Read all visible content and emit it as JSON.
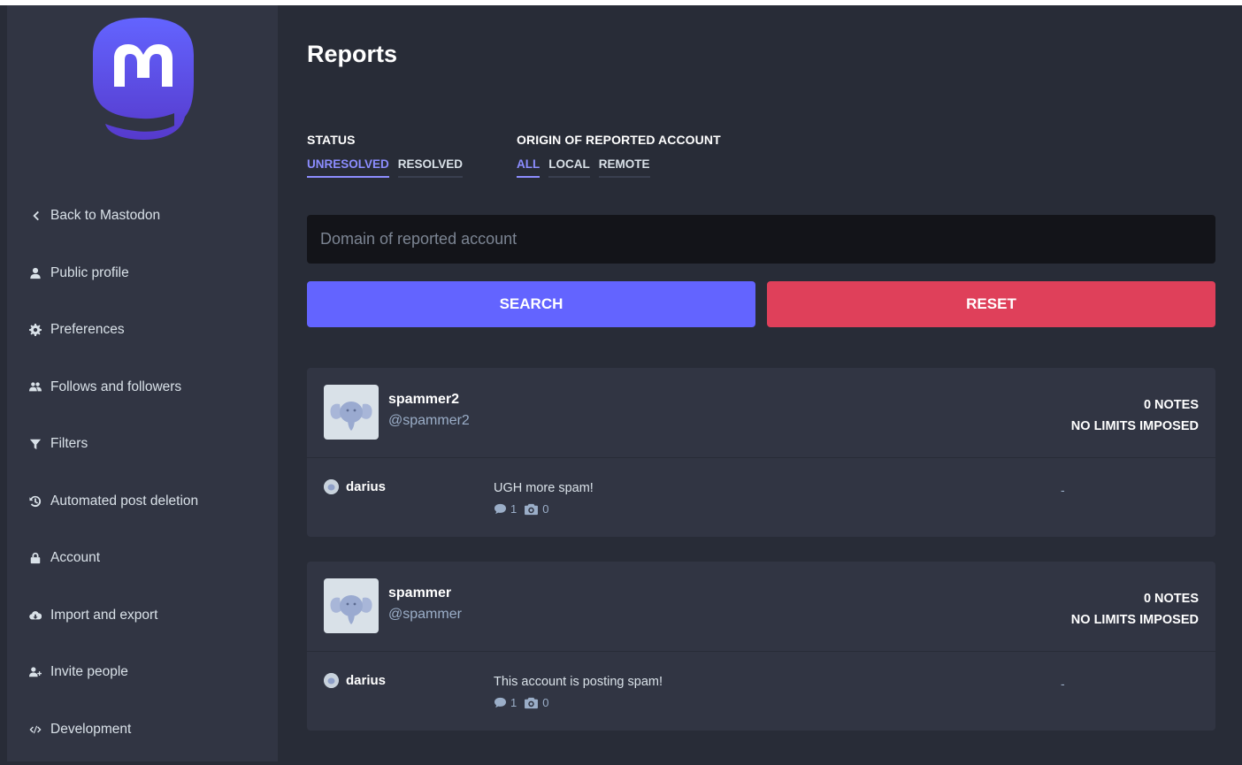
{
  "sidebar": {
    "logo_icon": "mastodon-logo-icon",
    "items": [
      {
        "label": "Back to Mastodon",
        "icon": "chevron-left-icon"
      },
      {
        "label": "Public profile",
        "icon": "user-icon"
      },
      {
        "label": "Preferences",
        "icon": "gear-icon"
      },
      {
        "label": "Follows and followers",
        "icon": "users-icon"
      },
      {
        "label": "Filters",
        "icon": "filter-icon"
      },
      {
        "label": "Automated post deletion",
        "icon": "history-icon"
      },
      {
        "label": "Account",
        "icon": "lock-icon"
      },
      {
        "label": "Import and export",
        "icon": "cloud-download-icon"
      },
      {
        "label": "Invite people",
        "icon": "user-plus-icon"
      },
      {
        "label": "Development",
        "icon": "code-icon"
      }
    ]
  },
  "page": {
    "title": "Reports"
  },
  "filters": {
    "status": {
      "title": "STATUS",
      "options": [
        "UNRESOLVED",
        "RESOLVED"
      ],
      "active": "UNRESOLVED"
    },
    "origin": {
      "title": "ORIGIN OF REPORTED ACCOUNT",
      "options": [
        "ALL",
        "LOCAL",
        "REMOTE"
      ],
      "active": "ALL"
    }
  },
  "search": {
    "placeholder": "Domain of reported account",
    "value": "",
    "search_label": "SEARCH",
    "reset_label": "RESET"
  },
  "reports": [
    {
      "name": "spammer2",
      "handle": "@spammer2",
      "notes": "0 NOTES",
      "limits": "NO LIMITS IMPOSED",
      "reporter": "darius",
      "comment": "UGH more spam!",
      "statuses_count": "1",
      "media_count": "0",
      "assignee": "-"
    },
    {
      "name": "spammer",
      "handle": "@spammer",
      "notes": "0 NOTES",
      "limits": "NO LIMITS IMPOSED",
      "reporter": "darius",
      "comment": "This account is posting spam!",
      "statuses_count": "1",
      "media_count": "0",
      "assignee": "-"
    }
  ],
  "colors": {
    "accent": "#6364ff",
    "danger": "#df405a",
    "link_active": "#8c8dff",
    "background": "#282c37",
    "sidebar": "#313543"
  }
}
